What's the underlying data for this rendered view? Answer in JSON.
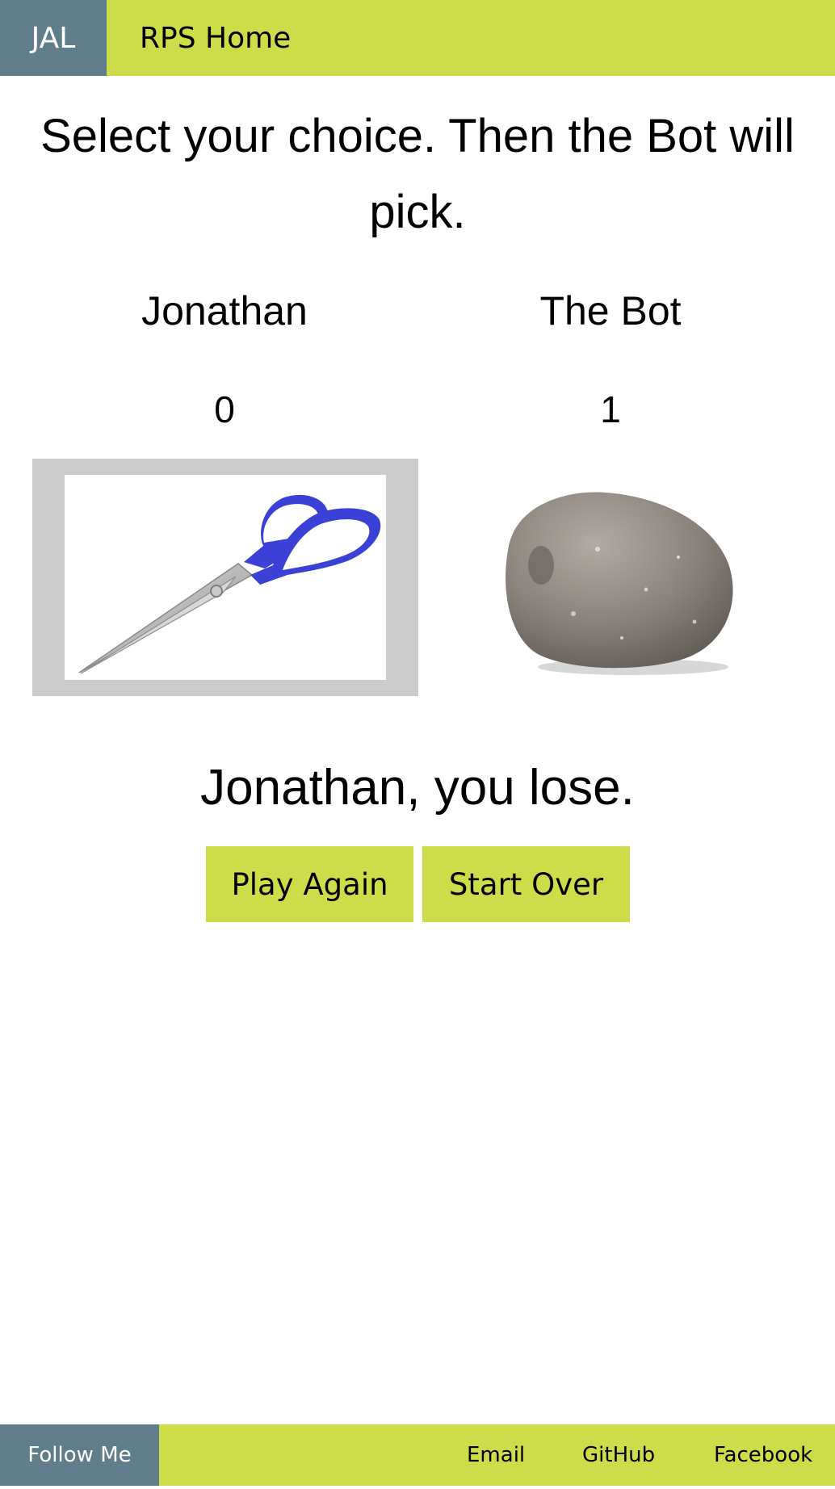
{
  "nav": {
    "logo": "JAL",
    "home_link": "RPS Home"
  },
  "prompt": "Select your choice. Then the Bot will pick.",
  "players": [
    {
      "name": "Jonathan",
      "score": "0",
      "choice_icon": "scissors-icon"
    },
    {
      "name": "The Bot",
      "score": "1",
      "choice_icon": "rock-icon"
    }
  ],
  "result": "Jonathan, you lose.",
  "buttons": {
    "play_again": "Play Again",
    "start_over": "Start Over"
  },
  "footer": {
    "follow_label": "Follow Me",
    "links": [
      "Email",
      "GitHub",
      "Facebook"
    ]
  },
  "colors": {
    "accent": "#cddc49",
    "brand": "#607d8b",
    "selected_frame": "#cccccc",
    "scissors_handle": "#3b41d6"
  }
}
